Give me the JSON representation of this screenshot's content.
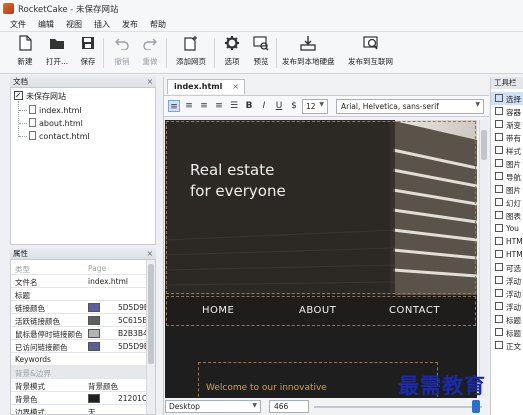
{
  "window": {
    "title": "RocketCake - 未保存网站"
  },
  "menu": [
    "文件",
    "编辑",
    "视图",
    "插入",
    "发布",
    "帮助"
  ],
  "toolbar": {
    "new": "新建",
    "open": "打开...",
    "save": "保存",
    "undo": "撤销",
    "redo": "重做",
    "add_page": "添加网页",
    "options": "选项",
    "preview": "预览",
    "publish_local": "发布到本地硬盘",
    "publish_web": "发布到互联网"
  },
  "files": {
    "header": "文档",
    "root": "未保存网站",
    "items": [
      "index.html",
      "about.html",
      "contact.html"
    ]
  },
  "properties": {
    "header": "属性",
    "rows": [
      {
        "k": "类型",
        "v": "Page",
        "muted": true
      },
      {
        "k": "文件名",
        "v": "index.html"
      },
      {
        "k": "标题",
        "v": ""
      },
      {
        "k": "链接颜色",
        "v": "5D5D9E",
        "color": "#5D5D9E"
      },
      {
        "k": "活跃链接颜色",
        "v": "5C615E",
        "color": "#5C615E"
      },
      {
        "k": "鼠标悬停时链接颜色",
        "v": "B2B3B4",
        "color": "#B2B3B4"
      },
      {
        "k": "已访问链接颜色",
        "v": "5D5D9E",
        "color": "#5D5D9E"
      },
      {
        "k": "Keywords",
        "v": ""
      },
      {
        "k": "背景&边界",
        "v": "",
        "section": true
      },
      {
        "k": "背景模式",
        "v": "背景颜色"
      },
      {
        "k": "背景色",
        "v": "21201C",
        "color": "#21201C"
      },
      {
        "k": "边界模式",
        "v": "无"
      }
    ]
  },
  "editor": {
    "tab": "index.html",
    "font_size": "12",
    "font_family": "Arial, Helvetica, sans-serif",
    "hero_line1": "Real estate",
    "hero_line2": "for everyone",
    "nav": [
      "HOME",
      "ABOUT",
      "CONTACT"
    ],
    "welcome": "Welcome to our innovative",
    "device": "Desktop",
    "width": "466"
  },
  "toolbox": {
    "header": "工具栏",
    "items": [
      "选择",
      "容器",
      "渐变",
      "带有",
      "样式",
      "图片",
      "导航",
      "图片",
      "幻灯",
      "图表",
      "You",
      "HTM",
      "HTM",
      "可选",
      "浮动",
      "浮动",
      "浮动",
      "标题",
      "标题",
      "正文"
    ]
  },
  "watermark": "最需教育"
}
